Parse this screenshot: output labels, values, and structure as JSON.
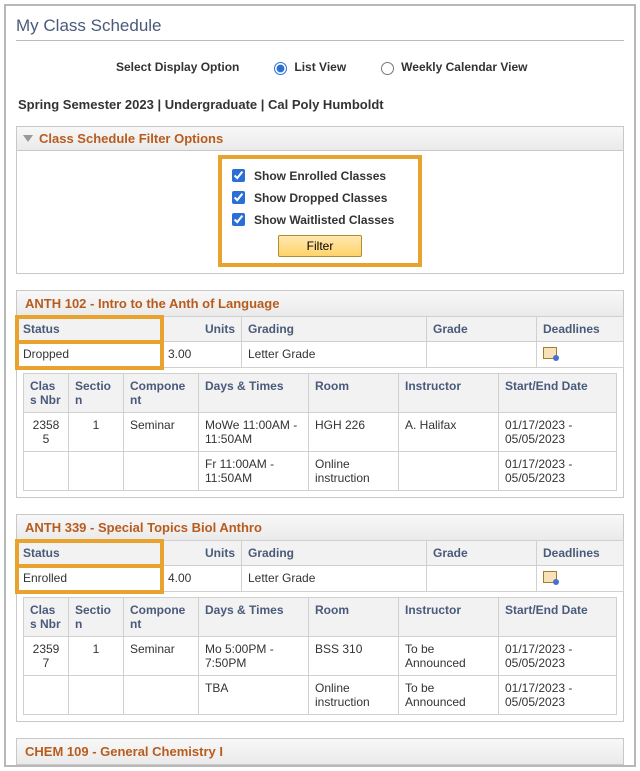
{
  "page": {
    "title": "My Class Schedule"
  },
  "displayOption": {
    "label": "Select Display Option",
    "listView": "List View",
    "weeklyView": "Weekly Calendar View"
  },
  "termLine": "Spring Semester 2023 | Undergraduate | Cal Poly Humboldt",
  "filter": {
    "header": "Class Schedule Filter Options",
    "enrolled": "Show Enrolled Classes",
    "dropped": "Show Dropped Classes",
    "waitlisted": "Show Waitlisted Classes",
    "button": "Filter"
  },
  "cols": {
    "status": "Status",
    "units": "Units",
    "grading": "Grading",
    "grade": "Grade",
    "deadlines": "Deadlines",
    "classNbr": "Class Nbr",
    "section": "Section",
    "component": "Component",
    "daysTimes": "Days & Times",
    "room": "Room",
    "instructor": "Instructor",
    "startEnd": "Start/End Date"
  },
  "course1": {
    "title": "ANTH 102 - Intro to the Anth of Language",
    "status": "Dropped",
    "units": "3.00",
    "grading": "Letter Grade",
    "grade": "",
    "rows": [
      {
        "nbr": "23585",
        "section": "1",
        "component": "Seminar",
        "days": "MoWe 11:00AM - 11:50AM",
        "room": "HGH 226",
        "instructor": "A. Halifax",
        "dates": "01/17/2023 - 05/05/2023"
      },
      {
        "nbr": "",
        "section": "",
        "component": "",
        "days": "Fr 11:00AM - 11:50AM",
        "room": "Online instruction",
        "instructor": "",
        "dates": "01/17/2023 - 05/05/2023"
      }
    ]
  },
  "course2": {
    "title": "ANTH 339 - Special Topics Biol Anthro",
    "status": "Enrolled",
    "units": "4.00",
    "grading": "Letter Grade",
    "grade": "",
    "rows": [
      {
        "nbr": "23597",
        "section": "1",
        "component": "Seminar",
        "days": "Mo 5:00PM - 7:50PM",
        "room": "BSS 310",
        "instructor": "To be Announced",
        "dates": "01/17/2023 - 05/05/2023"
      },
      {
        "nbr": "",
        "section": "",
        "component": "",
        "days": "TBA",
        "room": "Online instruction",
        "instructor": "To be Announced",
        "dates": "01/17/2023 - 05/05/2023"
      }
    ]
  },
  "course3": {
    "title": "CHEM 109 - General Chemistry I"
  }
}
